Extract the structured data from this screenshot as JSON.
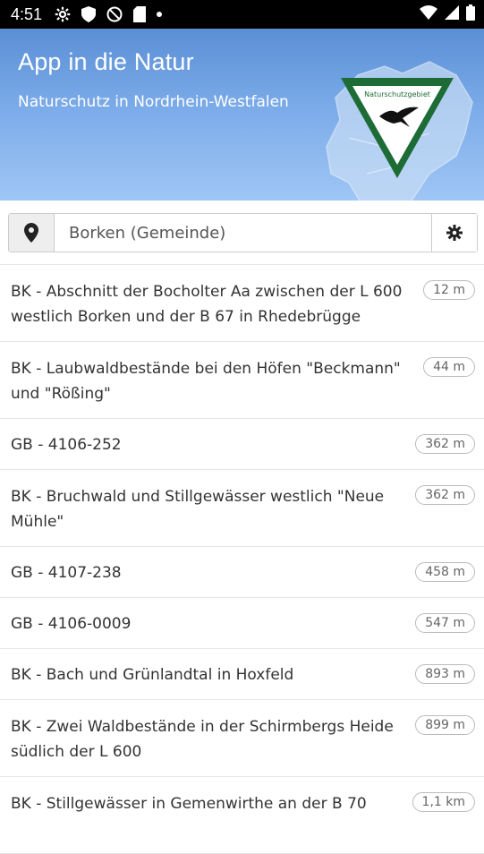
{
  "status_bar": {
    "time": "4:51"
  },
  "header": {
    "title": "App in die Natur",
    "subtitle": "Naturschutz in Nordrhein-Westfalen",
    "sign_text": "Naturschutzgebiet"
  },
  "search": {
    "value": "Borken (Gemeinde)"
  },
  "results": [
    {
      "title": "BK - Abschnitt der Bocholter Aa zwischen der L 600 westlich Borken und der B 67 in Rhedebrügge",
      "distance": "12 m"
    },
    {
      "title": "BK - Laubwaldbestände bei den Höfen \"Beckmann\" und \"Rößing\"",
      "distance": "44 m"
    },
    {
      "title": "GB - 4106-252",
      "distance": "362 m"
    },
    {
      "title": "BK - Bruchwald und Stillgewässer westlich \"Neue Mühle\"",
      "distance": "362 m"
    },
    {
      "title": "GB - 4107-238",
      "distance": "458 m"
    },
    {
      "title": "GB - 4106-0009",
      "distance": "547 m"
    },
    {
      "title": "BK - Bach und Grünlandtal in Hoxfeld",
      "distance": "893 m"
    },
    {
      "title": "BK - Zwei Waldbestände in der Schirmbergs Heide südlich der L 600",
      "distance": "899 m"
    },
    {
      "title": "BK - Stillgewässer in Gemenwirthe an der B 70",
      "distance": "1,1 km"
    }
  ]
}
